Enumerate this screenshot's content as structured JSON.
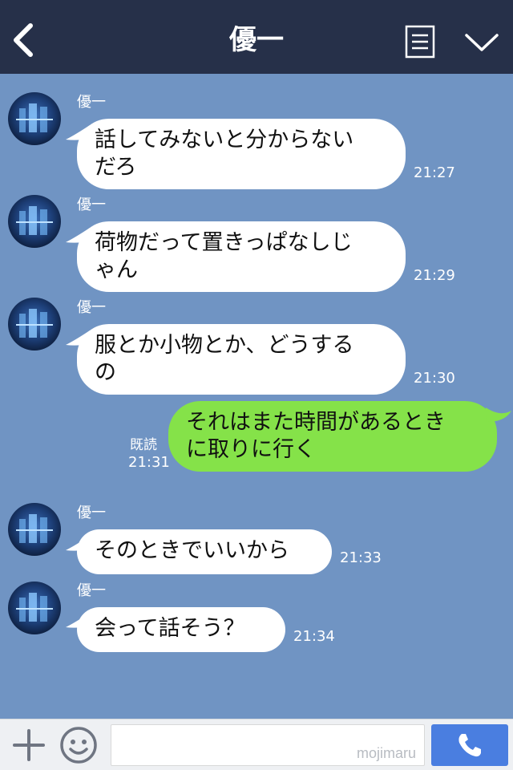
{
  "header": {
    "title": "優一",
    "back_icon": "chevron-left-icon",
    "menu_icon": "list-icon",
    "collapse_icon": "chevron-down-icon",
    "bg_color": "#263049"
  },
  "chat": {
    "bg_color": "#7094c3",
    "messages": [
      {
        "sender": "優一",
        "direction": "in",
        "lines": [
          "話してみないと分からない",
          "だろ"
        ],
        "time": "21:27"
      },
      {
        "sender": "優一",
        "direction": "in",
        "lines": [
          "荷物だって置きっぱなしじ",
          "ゃん"
        ],
        "time": "21:29"
      },
      {
        "sender": "優一",
        "direction": "in",
        "lines": [
          "服とか小物とか、どうする",
          "の"
        ],
        "time": "21:30"
      },
      {
        "direction": "out",
        "lines": [
          "それはまた時間があるとき",
          "に取りに行く"
        ],
        "read": "既読",
        "time": "21:31"
      },
      {
        "sender": "優一",
        "direction": "in",
        "lines": [
          "そのときでいいから"
        ],
        "time": "21:33"
      },
      {
        "sender": "優一",
        "direction": "in",
        "lines": [
          "会って話そう？"
        ],
        "time": "21:34"
      }
    ]
  },
  "footer": {
    "plus_icon": "plus-icon",
    "emoji_icon": "smiley-icon",
    "input_placeholder": "",
    "watermark": "mojimaru",
    "call_icon": "phone-icon",
    "call_color": "#4a7ee0"
  },
  "colors": {
    "incoming_bubble": "#ffffff",
    "outgoing_bubble": "#85e249"
  }
}
